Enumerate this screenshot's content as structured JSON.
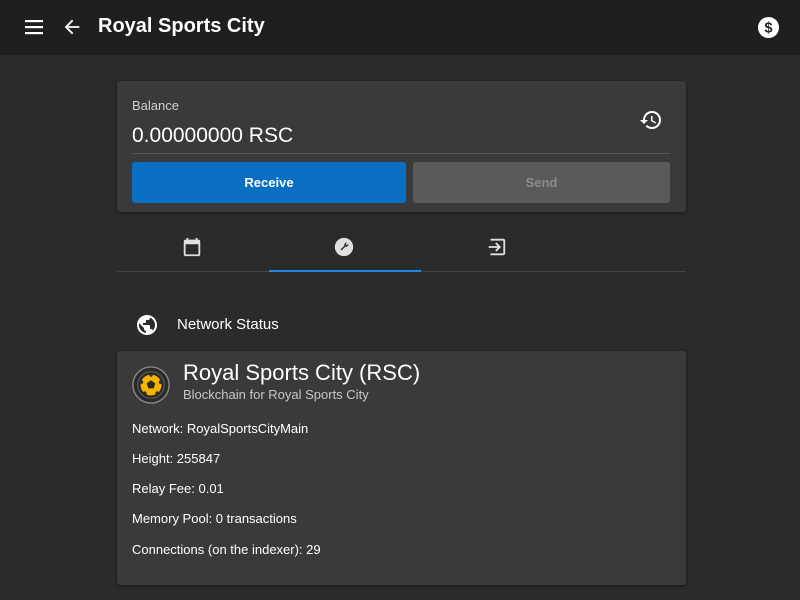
{
  "appbar": {
    "title": "Royal Sports City",
    "icons": [
      "menu-icon",
      "arrow-back-icon",
      "dollar-coin-icon"
    ]
  },
  "balance": {
    "label": "Balance",
    "value": "0.00000000 RSC",
    "history_icon": "history-icon",
    "receive_label": "Receive",
    "send_label": "Send"
  },
  "tabs": [
    {
      "icon": "calendar-icon",
      "active": false
    },
    {
      "icon": "wrench-icon",
      "active": true
    },
    {
      "icon": "login-icon",
      "active": false
    }
  ],
  "network_section": {
    "icon": "globe-icon",
    "title": "Network Status"
  },
  "coin": {
    "name": "Royal Sports City (RSC)",
    "subtitle": "Blockchain for Royal Sports City",
    "logo_icon": "football-logo-icon"
  },
  "stats": {
    "network": "Network: RoyalSportsCityMain",
    "height": "Height: 255847",
    "relay_fee": "Relay Fee: 0.01",
    "memory_pool": "Memory Pool: 0 transactions",
    "connections": "Connections (on the indexer): 29"
  },
  "colors": {
    "appbar": "#1f1f1f",
    "background": "#2b2b2b",
    "card": "#3a3a3a",
    "primary": "#0a6fc2",
    "tab_indicator": "#1e88e5",
    "logo_gold": "#f5b400"
  }
}
